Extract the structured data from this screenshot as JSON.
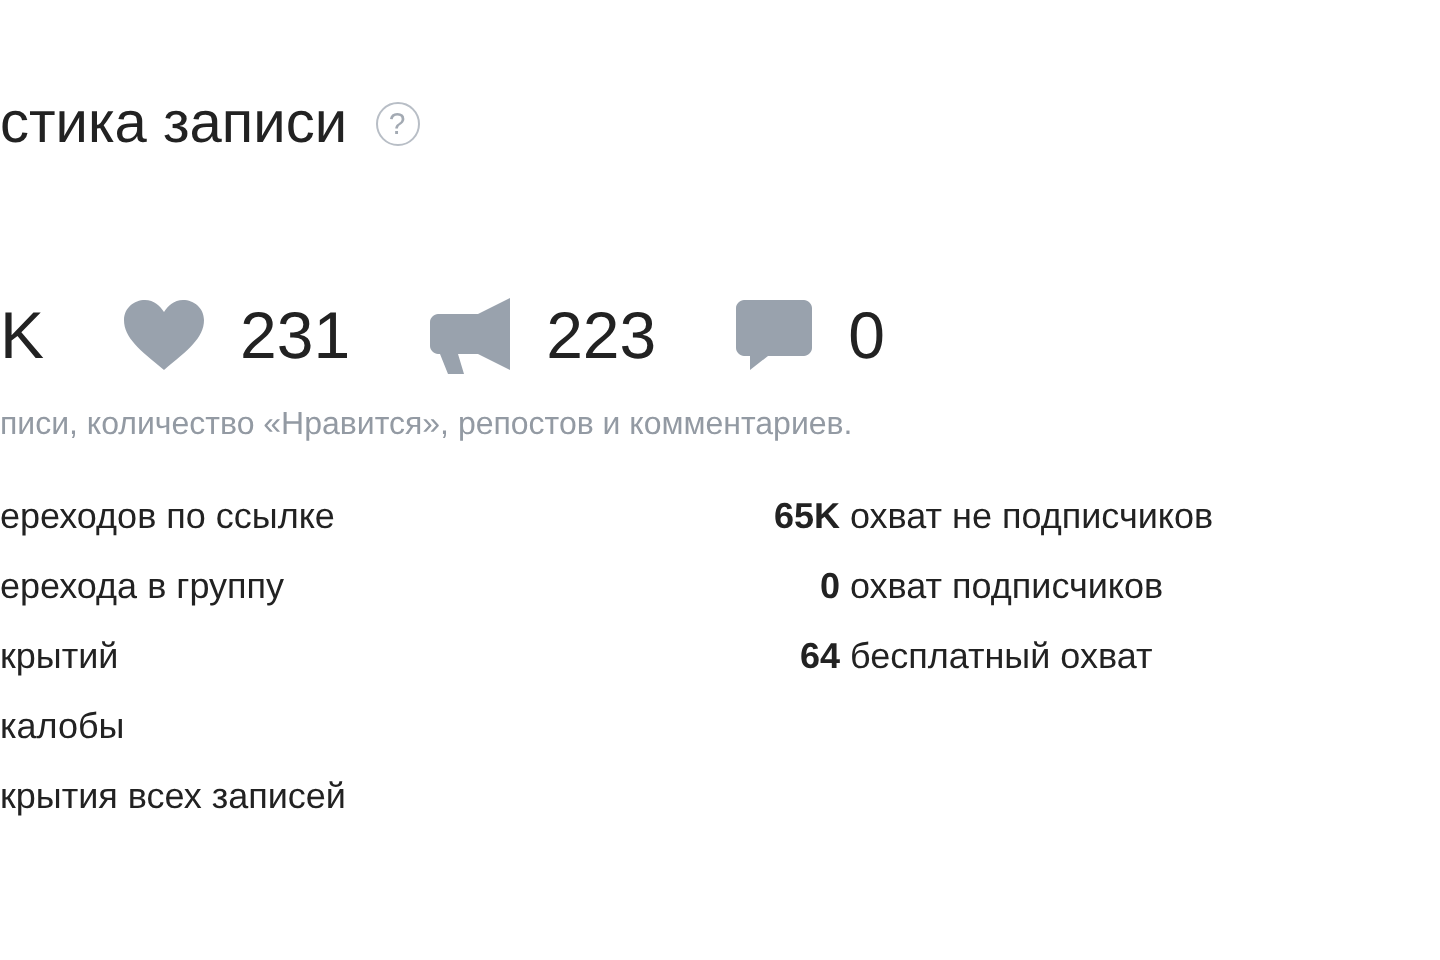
{
  "header": {
    "title": "стика записи",
    "help": "?"
  },
  "stats": [
    {
      "kind": "views",
      "value": "K"
    },
    {
      "kind": "likes",
      "value": "231"
    },
    {
      "kind": "reposts",
      "value": "223"
    },
    {
      "kind": "comments",
      "value": "0"
    }
  ],
  "caption": "писи, количество «Нравится», репостов и комментариев.",
  "left_list": [
    "ереходов по ссылке",
    "ерехода в группу",
    "крытий",
    "калобы",
    "крытия всех записей"
  ],
  "right_list": [
    {
      "value": "65K",
      "label": "охват не подписчиков"
    },
    {
      "value": "0",
      "label": "охват подписчиков"
    },
    {
      "value": "64",
      "label": "бесплатный охват"
    }
  ]
}
